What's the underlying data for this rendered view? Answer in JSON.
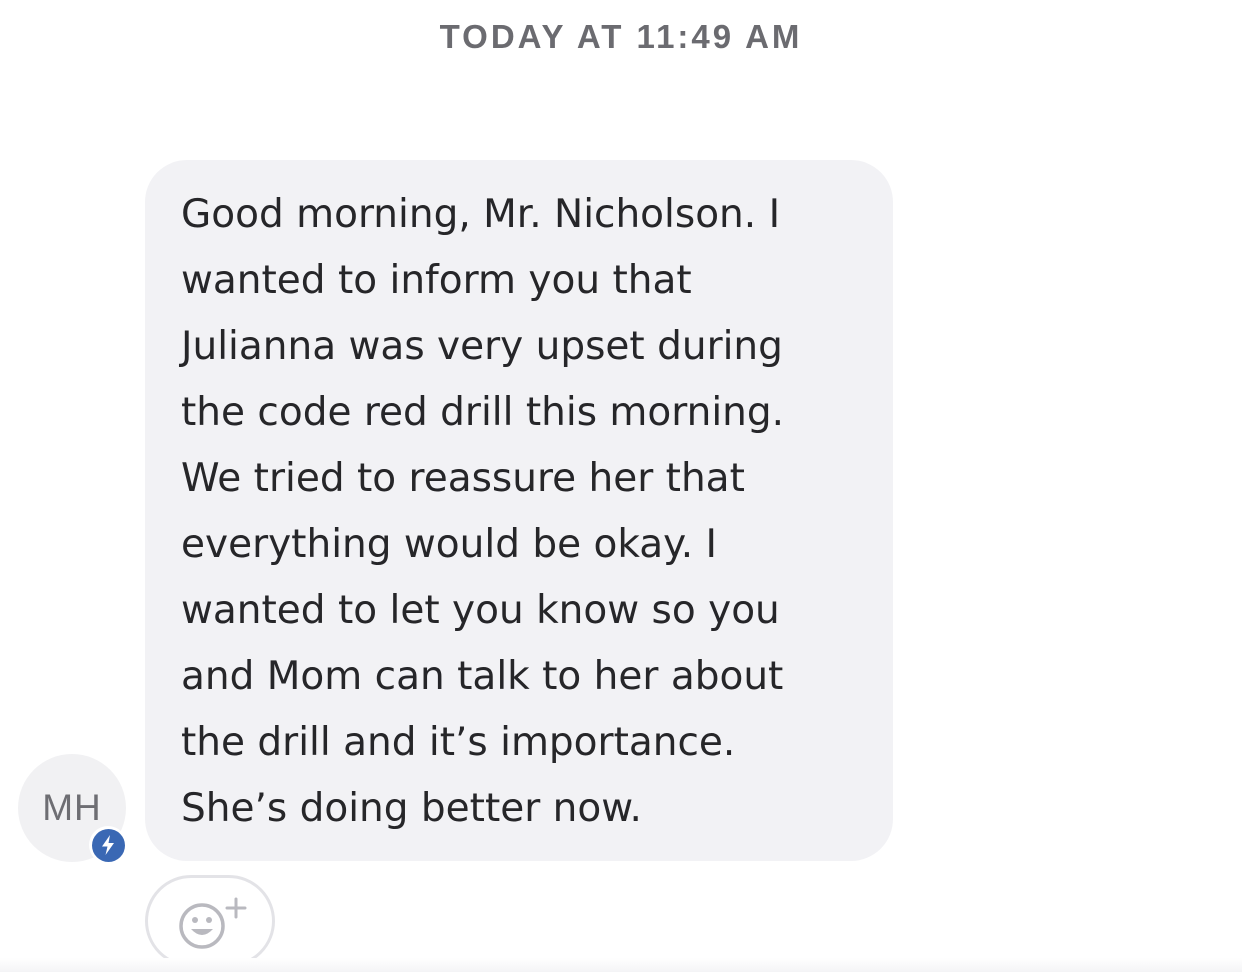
{
  "header": {
    "timestamp": "TODAY AT 11:49 AM"
  },
  "message": {
    "sender_initials": "MH",
    "badge_icon": "lightning-bolt-icon",
    "text": "Good morning, Mr. Nicholson.  I\nwanted to inform you that\nJulianna was very upset during\nthe code red drill this morning.\nWe tried to reassure her that\neverything would be okay.  I\nwanted to let you know so you\nand Mom can talk to her about\nthe drill and it’s importance.\nShe’s doing better now."
  },
  "reaction": {
    "icon": "add-emoji-reaction-icon"
  },
  "colors": {
    "bubble_background": "#f2f2f5",
    "badge_blue": "#3a68b4",
    "text": "#262629",
    "timestamp": "#6b6b70"
  }
}
